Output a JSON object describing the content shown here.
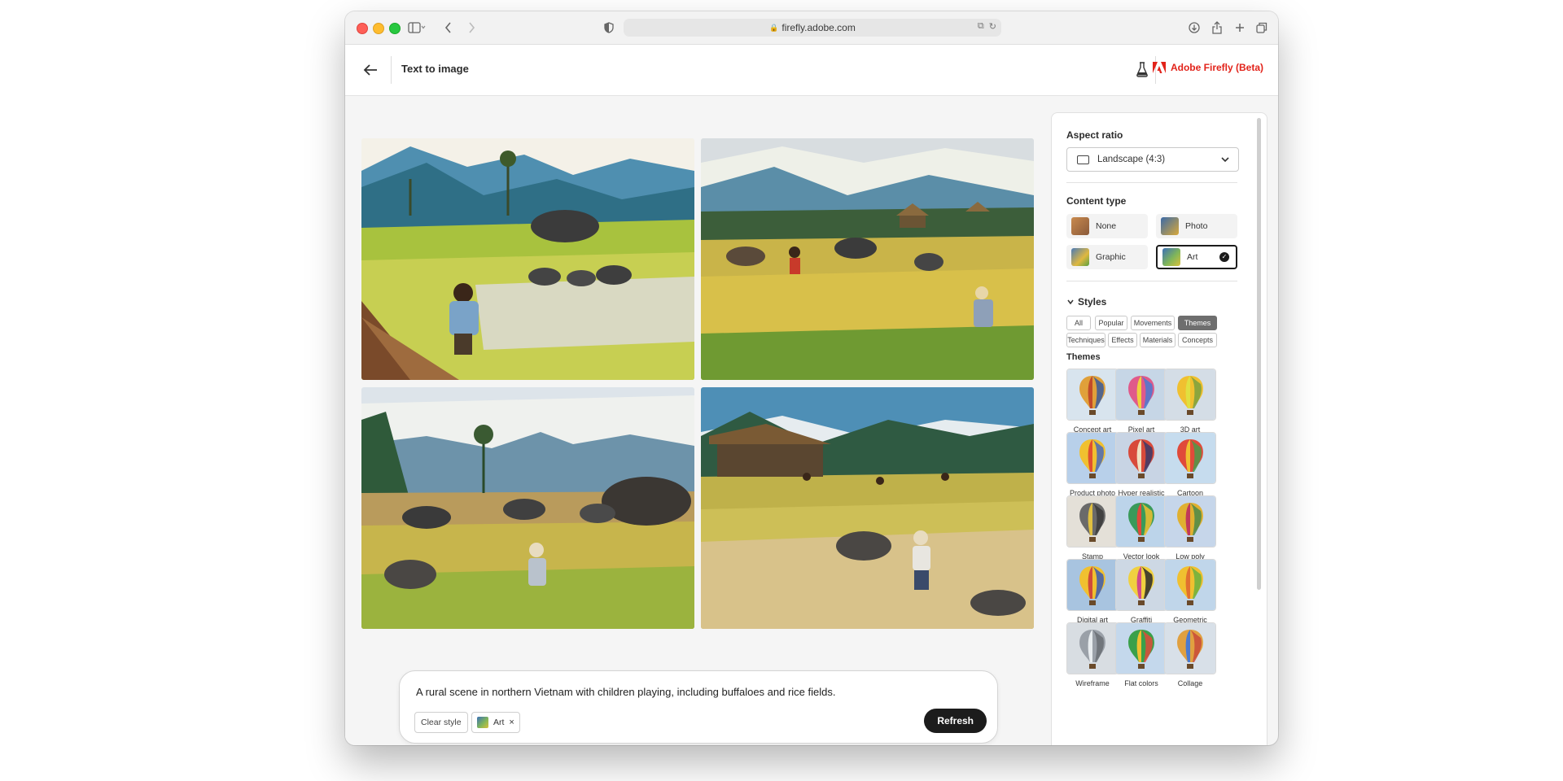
{
  "browser": {
    "url": "firefly.adobe.com"
  },
  "header": {
    "page_title": "Text to image",
    "brand": "Adobe Firefly (Beta)"
  },
  "prompt": {
    "text": "A rural scene in northern Vietnam with children playing, including buffaloes and rice fields.",
    "clear_style_label": "Clear style",
    "style_chip_label": "Art",
    "chip_remove": "×",
    "refresh_label": "Refresh"
  },
  "panel": {
    "aspect_ratio_label": "Aspect ratio",
    "aspect_ratio_value": "Landscape (4:3)",
    "content_type_label": "Content type",
    "content_types": [
      {
        "label": "None",
        "selected": false
      },
      {
        "label": "Photo",
        "selected": false
      },
      {
        "label": "Graphic",
        "selected": false
      },
      {
        "label": "Art",
        "selected": true
      }
    ],
    "styles_label": "Styles",
    "style_filters": [
      {
        "label": "All",
        "active": false
      },
      {
        "label": "Popular",
        "active": false
      },
      {
        "label": "Movements",
        "active": false
      },
      {
        "label": "Themes",
        "active": true
      },
      {
        "label": "Techniques",
        "active": false
      },
      {
        "label": "Effects",
        "active": false
      },
      {
        "label": "Materials",
        "active": false
      },
      {
        "label": "Concepts",
        "active": false
      }
    ],
    "themes_label": "Themes",
    "themes": [
      "Concept art",
      "Pixel art",
      "3D art",
      "Product photo",
      "Hyper realistic",
      "Cartoon",
      "Stamp",
      "Vector look",
      "Low poly",
      "Digital art",
      "Graffiti",
      "Geometric",
      "Wireframe",
      "Flat colors",
      "Collage"
    ]
  },
  "colors": {
    "brand_red": "#e2231a",
    "button_dark": "#1c1c1c",
    "active_pill": "#6e6e6e"
  },
  "icons": [
    "back-arrow-icon",
    "beaker-icon",
    "adobe-logo-icon",
    "chevron-down-icon",
    "checkmark-icon",
    "sidebar-icon",
    "share-icon",
    "download-icon",
    "plus-icon",
    "tabs-icon",
    "reload-icon",
    "shield-icon"
  ]
}
